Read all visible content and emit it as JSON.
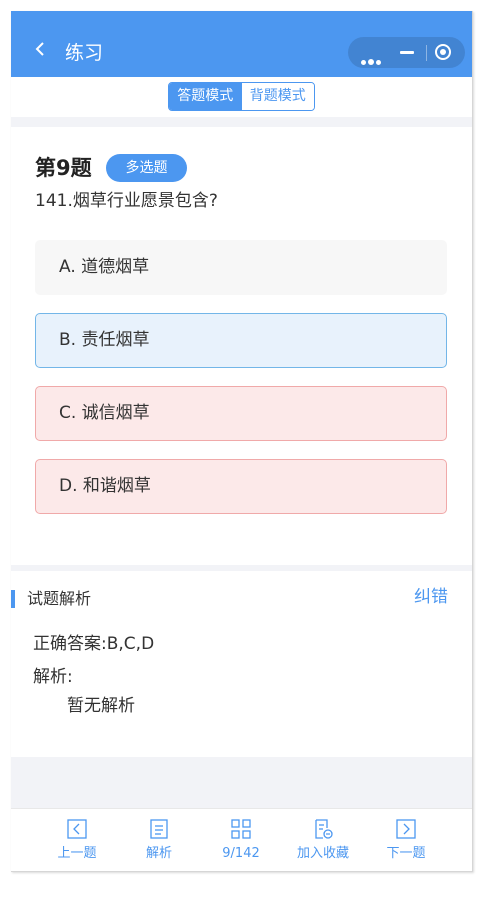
{
  "navbar": {
    "title": "练习",
    "back_icon": "chevron-left-icon",
    "capsule_more_icon": "more-dots-icon",
    "capsule_minimize_icon": "minus-icon",
    "capsule_close_icon": "target-icon"
  },
  "mode": {
    "answer_mode": "答题模式",
    "recite_mode": "背题模式",
    "active": "answer_mode"
  },
  "question": {
    "number_label": "第9题",
    "type_badge": "多选题",
    "text": "141.烟草行业愿景包含?",
    "options": [
      {
        "label": "A. 道德烟草",
        "state": "default"
      },
      {
        "label": "B. 责任烟草",
        "state": "correct-selected"
      },
      {
        "label": "C. 诚信烟草",
        "state": "missed"
      },
      {
        "label": "D. 和谐烟草",
        "state": "missed"
      }
    ]
  },
  "analysis": {
    "title": "试题解析",
    "report_link": "纠错",
    "answer_label": "正确答案:",
    "answer_value": "B,C,D",
    "explain_label": "解析:",
    "explain_text": "暂无解析"
  },
  "tabbar": {
    "items": [
      {
        "label": "上一题",
        "icon": "prev-icon"
      },
      {
        "label": "解析",
        "icon": "document-icon"
      },
      {
        "label": "9/142",
        "icon": "grid-icon"
      },
      {
        "label": "加入收藏",
        "icon": "favorite-icon"
      },
      {
        "label": "下一题",
        "icon": "next-icon"
      }
    ]
  },
  "colors": {
    "accent": "#4c97f0",
    "correct_bg": "#e8f2fc",
    "correct_border": "#73b6e8",
    "missed_bg": "#fce9e9",
    "missed_border": "#f0a9a9"
  }
}
